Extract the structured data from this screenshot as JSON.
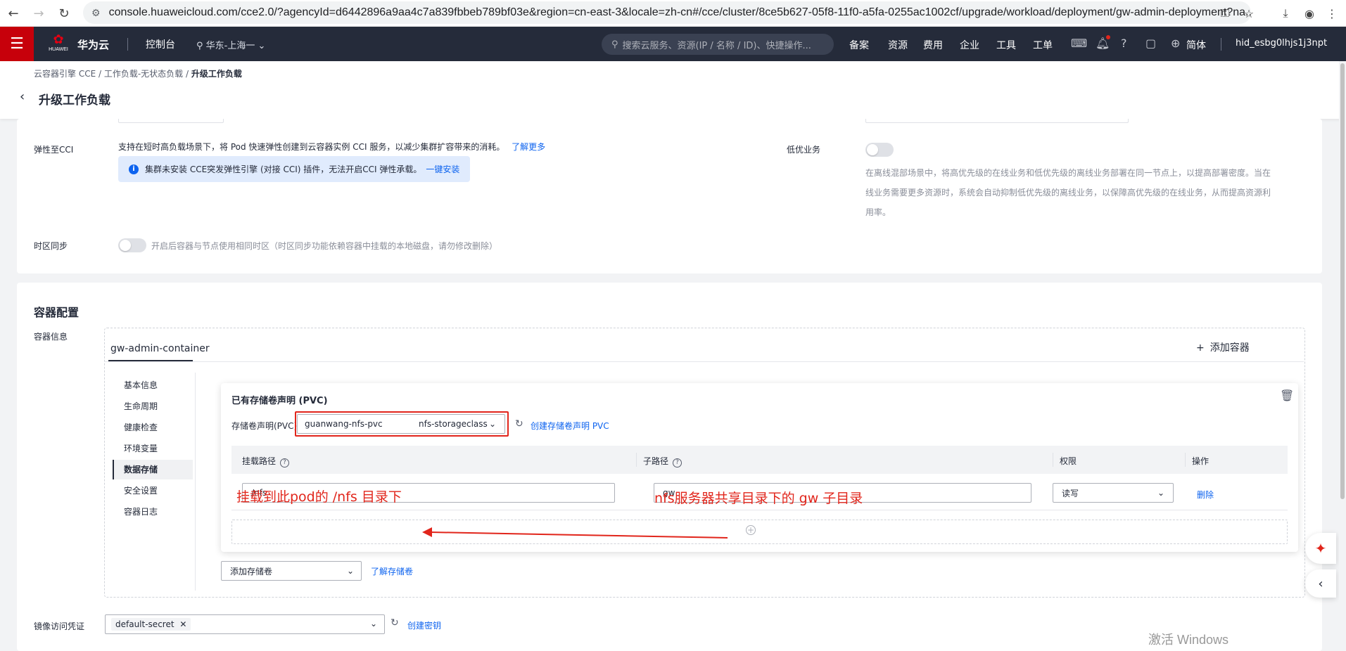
{
  "browser": {
    "url": "console.huaweicloud.com/cce2.0/?agencyId=d6442896a9aa4c7a839fbbeb789bf03e&region=cn-east-3&locale=zh-cn#/cce/cluster/8ce5b627-05f8-11f0-a5fa-0255ac1002cf/upgrade/workload/deployment/gw-admin-deployment?na..."
  },
  "topnav": {
    "logo_text": "HUAWEI",
    "brand": "华为云",
    "console": "控制台",
    "region": "华东-上海一",
    "search_placeholder": "搜索云服务、资源(IP / 名称 / ID)、快捷操作...",
    "items": [
      "备案",
      "资源",
      "费用",
      "企业",
      "工具",
      "工单"
    ],
    "lang": "简体",
    "user": "hid_esbg0lhjs1j3npt"
  },
  "header": {
    "breadcrumb": [
      "云容器引擎 CCE",
      "工作负载-无状态负载",
      "升级工作负载"
    ],
    "title": "升级工作负载"
  },
  "elastic": {
    "label": "弹性至CCI",
    "desc": "支持在短时高负载场景下，将 Pod 快速弹性创建到云容器实例 CCI 服务，以减少集群扩容带来的消耗。",
    "learn_more": "了解更多",
    "info_text": "集群未安装 CCE突发弹性引擎 (对接 CCI) 插件，无法开启CCI 弹性承载。",
    "install_link": "一键安装"
  },
  "low_priority": {
    "label": "低优业务",
    "desc": "在离线混部场景中，将高优先级的在线业务和低优先级的离线业务部署在同一节点上，以提高部署密度。当在线业务需要更多资源时，系统会自动抑制低优先级的离线业务，以保障高优先级的在线业务，从而提高资源利用率。"
  },
  "timezone": {
    "label": "时区同步",
    "desc": "开启后容器与节点使用相同时区（时区同步功能依赖容器中挂载的本地磁盘，请勿修改删除）"
  },
  "container_config": {
    "title": "容器配置",
    "info_label": "容器信息",
    "tab": "gw-admin-container",
    "add_container": "添加容器",
    "side_menu": [
      "基本信息",
      "生命周期",
      "健康检查",
      "环境变量",
      "数据存储",
      "安全设置",
      "容器日志"
    ],
    "active_index": 4
  },
  "pvc": {
    "title": "已有存储卷声明 (PVC)",
    "label": "存储卷声明(PVC)",
    "selected_name": "guanwang-nfs-pvc",
    "selected_class": "nfs-storageclass",
    "create_link": "创建存储卷声明 PVC",
    "columns": [
      "挂载路径",
      "子路径",
      "权限",
      "操作"
    ],
    "row": {
      "mount_path": "/nfs",
      "sub_path": "gw",
      "permission": "读写",
      "action": "删除"
    }
  },
  "annotations": {
    "left": "挂载到此pod的 /nfs 目录下",
    "right": "nfs服务器共享目录下的 gw 子目录"
  },
  "storage": {
    "add_volume": "添加存储卷",
    "learn_link": "了解存储卷"
  },
  "secret": {
    "label": "镜像访问凭证",
    "chip": "default-secret",
    "create_link": "创建密钥"
  },
  "watermark": "激活 Windows",
  "colors": {
    "brand_red": "#c7000b",
    "nav_bg": "#252b3a",
    "link_blue": "#0d63ef",
    "annotation_red": "#e1251b"
  }
}
